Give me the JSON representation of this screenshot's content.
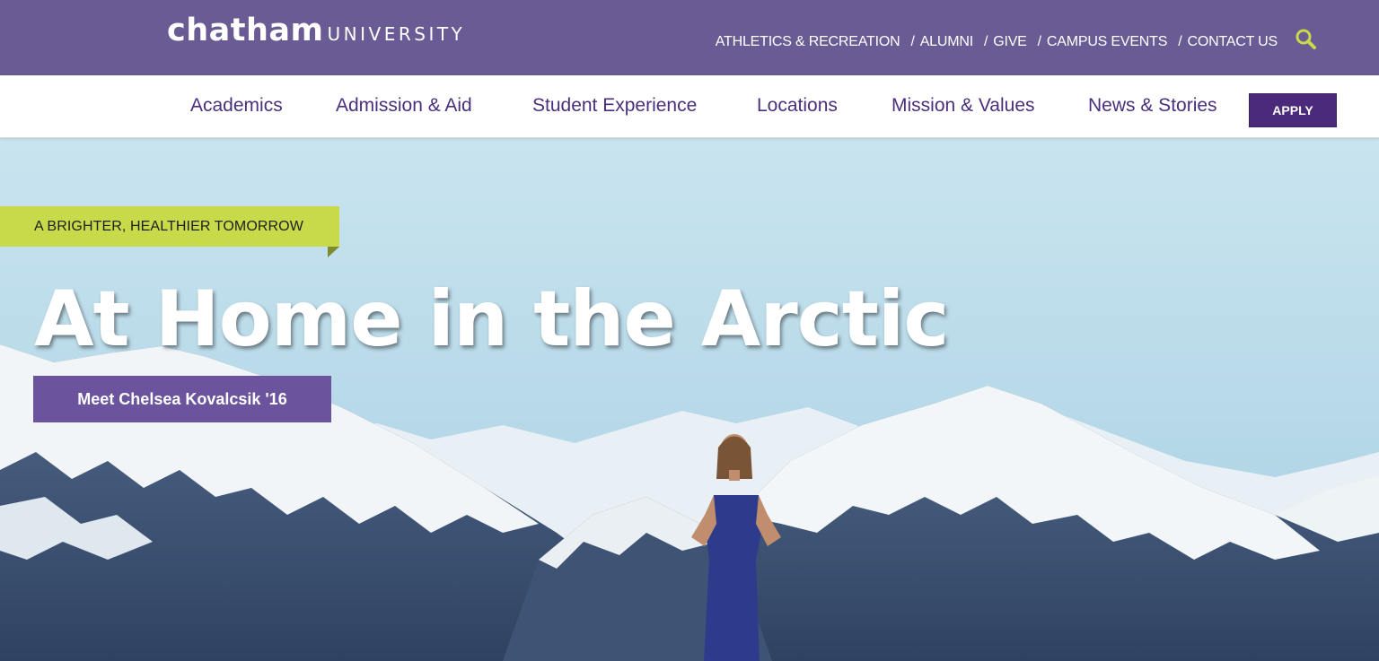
{
  "header": {
    "logo": {
      "main": "chatham",
      "sub": "UNIVERSITY"
    },
    "utility_links": [
      {
        "label": "ATHLETICS & RECREATION"
      },
      {
        "label": "ALUMNI"
      },
      {
        "label": "GIVE"
      },
      {
        "label": "CAMPUS EVENTS"
      },
      {
        "label": "CONTACT US"
      }
    ],
    "separator": "/",
    "search_icon": "magnifier-icon"
  },
  "main_nav": {
    "items": [
      {
        "label": "Academics"
      },
      {
        "label": "Admission & Aid"
      },
      {
        "label": "Student Experience"
      },
      {
        "label": "Locations"
      },
      {
        "label": "Mission & Values"
      },
      {
        "label": "News & Stories"
      }
    ],
    "apply_label": "APPLY"
  },
  "hero": {
    "eyebrow": "A BRIGHTER, HEALTHIER TOMORROW",
    "title": "At Home in the Arctic",
    "cta_label": "Meet Chelsea Kovalcsik '16"
  },
  "colors": {
    "brand_purple": "#6a5b95",
    "nav_text": "#4a2f7d",
    "apply_bg": "#4b2a7b",
    "eyebrow_bg": "#c8da4a",
    "search_icon": "#c8da4a",
    "cta_bg": "#6b549d"
  }
}
